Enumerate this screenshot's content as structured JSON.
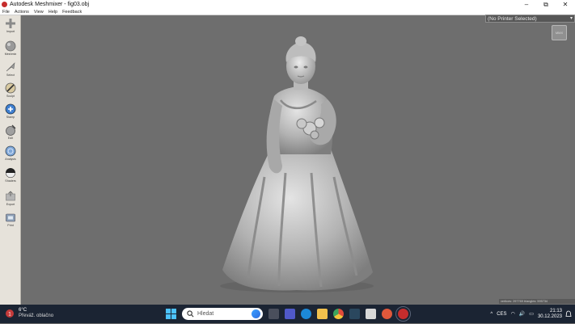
{
  "window": {
    "title": "Autodesk Meshmixer - fig03.obj",
    "minimize": "–",
    "maximize": "⧉",
    "close": "✕"
  },
  "menu": [
    "File",
    "Actions",
    "View",
    "Help",
    "Feedback"
  ],
  "tools": [
    {
      "label": "Import",
      "icon": "plus-icon"
    },
    {
      "label": "Meshmix",
      "icon": "sphere-icon"
    },
    {
      "label": "Select",
      "icon": "arrow-select-icon"
    },
    {
      "label": "Sculpt",
      "icon": "brush-icon"
    },
    {
      "label": "Stamp",
      "icon": "stamp-icon"
    },
    {
      "label": "Edit",
      "icon": "edit-sphere-icon"
    },
    {
      "label": "Analysis",
      "icon": "analysis-icon"
    },
    {
      "label": "Shaders",
      "icon": "shader-icon"
    },
    {
      "label": "Export",
      "icon": "export-icon"
    },
    {
      "label": "Print",
      "icon": "print-icon"
    }
  ],
  "viewport": {
    "printer_select": "(No Printer Selected)",
    "panel_button": "MMX",
    "mesh_stats": "vertices: 297769 triangles: 595734"
  },
  "taskbar": {
    "weather_temp": "6°C",
    "weather_desc": "Převáž. oblačno",
    "search_placeholder": "Hledat",
    "lang": "CES",
    "time": "21:13",
    "date": "30.12.2023"
  },
  "colors": {
    "accent": "#4cc2ff",
    "taskbar": "#1b2433",
    "viewport": "#6e6e6e",
    "toolbar": "#e6e2da"
  }
}
